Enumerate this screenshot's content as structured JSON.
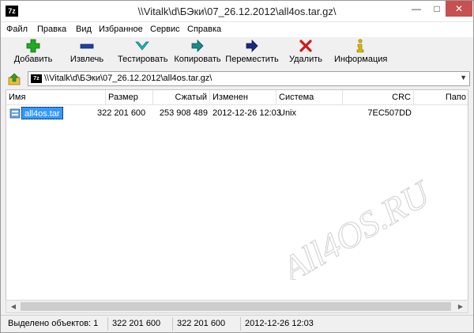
{
  "window": {
    "title": "\\\\Vitalk\\d\\БЭки\\07_26.12.2012\\all4os.tar.gz\\",
    "app_icon_text": "7z"
  },
  "menu": [
    "Файл",
    "Правка",
    "Вид",
    "Избранное",
    "Сервис",
    "Справка"
  ],
  "toolbar": {
    "add": "Добавить",
    "extract": "Извлечь",
    "test": "Тестировать",
    "copy": "Копировать",
    "move": "Переместить",
    "delete": "Удалить",
    "info": "Информация"
  },
  "address": {
    "path": "\\\\Vitalk\\d\\БЭки\\07_26.12.2012\\all4os.tar.gz\\"
  },
  "columns": [
    "Имя",
    "Размер",
    "Сжатый",
    "Изменен",
    "Система",
    "CRC",
    "Папо"
  ],
  "rows": [
    {
      "name": "all4os.tar",
      "size": "322 201 600",
      "packed": "253 908 489",
      "modified": "2012-12-26 12:03",
      "system": "Unix",
      "crc": "7EC507DD"
    }
  ],
  "status": {
    "selected": "Выделено объектов: 1",
    "size": "322 201 600",
    "packed": "322 201 600",
    "modified": "2012-12-26 12:03"
  },
  "watermark": "All4OS.RU",
  "colors": {
    "selection": "#3399ff",
    "close_button": "#c75050",
    "add_icon": "#22aa22",
    "extract_icon": "#2040a0",
    "test_icon": "#20b8c0",
    "delete_icon": "#d01818",
    "info_icon": "#d8b800"
  }
}
